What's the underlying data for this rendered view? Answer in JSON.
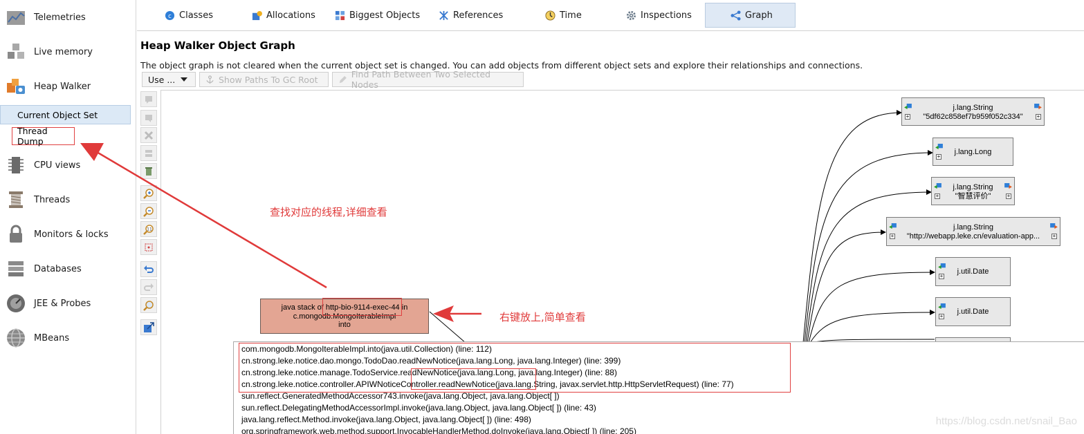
{
  "sidebar": {
    "items": [
      {
        "label": "Telemetries",
        "icon": "telemetries-icon"
      },
      {
        "label": "Live memory",
        "icon": "live-memory-icon"
      },
      {
        "label": "Heap Walker",
        "icon": "heap-walker-icon"
      },
      {
        "label": "CPU views",
        "icon": "cpu-icon"
      },
      {
        "label": "Threads",
        "icon": "threads-icon"
      },
      {
        "label": "Monitors & locks",
        "icon": "lock-icon"
      },
      {
        "label": "Databases",
        "icon": "database-icon"
      },
      {
        "label": "JEE & Probes",
        "icon": "probe-icon"
      },
      {
        "label": "MBeans",
        "icon": "globe-icon"
      }
    ],
    "sub_items": {
      "current_object_set": "Current Object Set",
      "thread_dump": "Thread Dump"
    }
  },
  "tabs": [
    {
      "label": "Classes",
      "icon": "classes-icon"
    },
    {
      "label": "Allocations",
      "icon": "allocations-icon"
    },
    {
      "label": "Biggest Objects",
      "icon": "biggest-objects-icon"
    },
    {
      "label": "References",
      "icon": "references-icon"
    },
    {
      "label": "Time",
      "icon": "clock-icon"
    },
    {
      "label": "Inspections",
      "icon": "gear-icon"
    },
    {
      "label": "Graph",
      "icon": "graph-icon",
      "active": true
    }
  ],
  "main": {
    "title": "Heap Walker Object Graph",
    "description": "The object graph is not cleared when the current object set is changed. You can add objects from different object sets and explore their relationships and connections."
  },
  "toolbar": {
    "use_label": "Use ...",
    "show_paths_label": "Show Paths To GC Root",
    "find_path_label": "Find Path Between Two Selected Nodes"
  },
  "graph": {
    "nodes": [
      {
        "cls": "j.lang.String",
        "value": "\"5df62c858ef7b959f052c334\""
      },
      {
        "cls": "j.lang.Long",
        "value": ""
      },
      {
        "cls": "j.lang.String",
        "value": "\"智慧评价\""
      },
      {
        "cls": "j.lang.String",
        "value": "\"http://webapp.leke.cn/evaluation-app..."
      },
      {
        "cls": "j.util.Date",
        "value": ""
      },
      {
        "cls": "j.util.Date",
        "value": ""
      }
    ],
    "stack_node": {
      "line1_prefix": "java stack of ",
      "line1_thread": "http-bio-9114-exec-44",
      "line1_suffix": " in",
      "line2": "c.mongodb.MongoIterableImpl",
      "line3": "into"
    }
  },
  "popup": {
    "lines": [
      "com.mongodb.MongoIterableImpl.into(java.util.Collection) (line: 112)",
      "cn.strong.leke.notice.dao.mongo.TodoDao.readNewNotice(java.lang.Long, java.lang.Integer) (line: 399)",
      "cn.strong.leke.notice.manage.TodoService.readNewNotice(java.lang.Long, java.lang.Integer) (line: 88)",
      "cn.strong.leke.notice.controller.APIWNoticeController.readNewNotice(java.lang.String, javax.servlet.http.HttpServletRequest) (line: 77)",
      "sun.reflect.GeneratedMethodAccessor743.invoke(java.lang.Object, java.lang.Object[ ])",
      "sun.reflect.DelegatingMethodAccessorImpl.invoke(java.lang.Object, java.lang.Object[ ]) (line: 43)",
      "java.lang.reflect.Method.invoke(java.lang.Object, java.lang.Object[ ]) (line: 498)",
      "org.springframework.web.method.support.InvocableHandlerMethod.doInvoke(java.lang.Object[ ]) (line: 205)"
    ]
  },
  "annotations": {
    "find_thread": "查找对应的线程,详细查看",
    "right_click": "右键放上,简单查看"
  },
  "watermark": "https://blog.csdn.net/snail_Bao",
  "colors": {
    "annotation_red": "#e03a3a",
    "stack_node_fill": "#e3a593",
    "active_tab": "#dfe9f5",
    "node_fill": "#e8e8e8"
  }
}
